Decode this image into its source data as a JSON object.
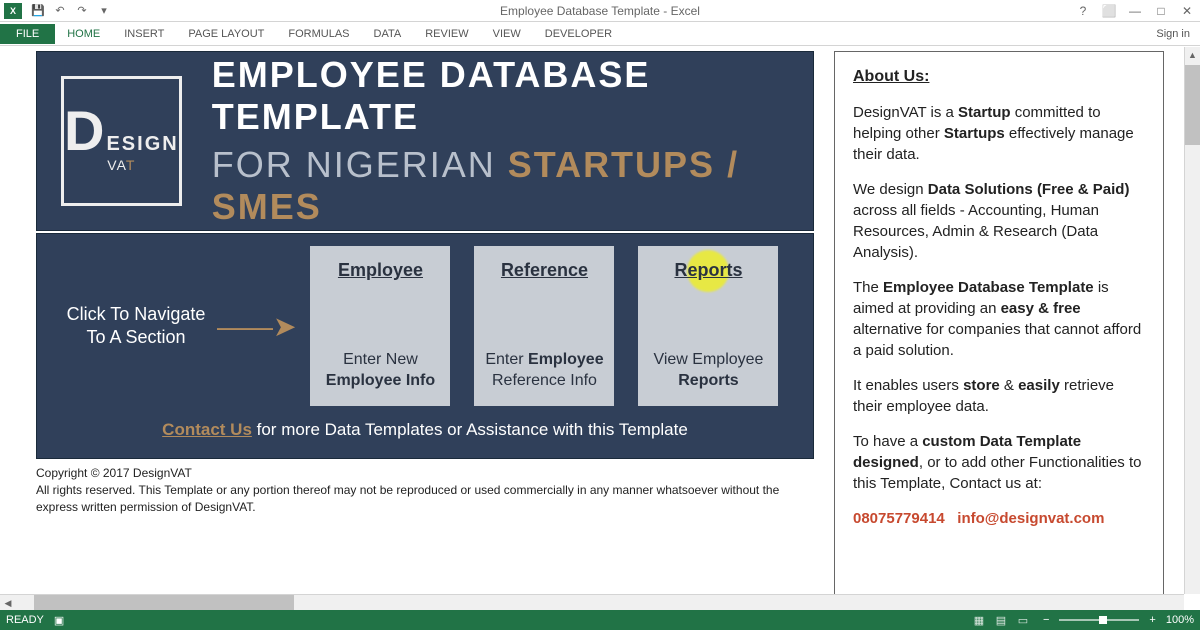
{
  "titlebar": {
    "doc_title": "Employee Database Template - Excel",
    "help_icon": "?",
    "restore_icon": "⬜",
    "min_icon": "—",
    "max_icon": "□",
    "close_icon": "✕"
  },
  "ribbon": {
    "file": "FILE",
    "tabs": [
      "HOME",
      "INSERT",
      "PAGE LAYOUT",
      "FORMULAS",
      "DATA",
      "REVIEW",
      "VIEW",
      "DEVELOPER"
    ],
    "signin": "Sign in"
  },
  "hero": {
    "logo_top": "D",
    "logo_side": "ESIGN",
    "logo_bottom_pre": "VA",
    "logo_bottom_accent": "T",
    "line1": "EMPLOYEE DATABASE TEMPLATE",
    "line2_for": "FOR NIGERIAN ",
    "line2_accent": "STARTUPS / SMES"
  },
  "nav": {
    "hint_l1": "Click To Navigate",
    "hint_l2": "To A Section",
    "arrow": "――➤",
    "cards": [
      {
        "title": "Employee",
        "desc_pre": "Enter New",
        "desc_bold": "Employee Info",
        "highlight": false
      },
      {
        "title": "Reference",
        "desc_pre": "Enter ",
        "desc_bold": "Employee",
        "desc_post": " Reference Info",
        "highlight": false
      },
      {
        "title": "Reports",
        "desc_pre": "View Employee",
        "desc_bold": "Reports",
        "highlight": true
      }
    ],
    "contact_link": "Contact Us",
    "contact_rest": " for more Data Templates or Assistance with this Template"
  },
  "copyright": {
    "line1": "Copyright © 2017 DesignVAT",
    "line2": "All rights reserved. This Template or any portion thereof may not be reproduced or used commercially in any manner whatsoever without the express written permission of DesignVAT."
  },
  "info": {
    "title": "About Us:",
    "p1_pre": "DesignVAT is a ",
    "p1_b1": "Startup",
    "p1_mid": " committed to helping other ",
    "p1_b2": "Startups",
    "p1_post": " effectively manage their data.",
    "p2_pre": "We design ",
    "p2_b": "Data Solutions (Free & Paid)",
    "p2_post": " across all fields - Accounting, Human Resources, Admin & Research (Data Analysis).",
    "p3_pre": "The ",
    "p3_b1": "Employee Database Template",
    "p3_mid": " is aimed at providing an ",
    "p3_b2": "easy & free",
    "p3_post": " alternative for companies that cannot afford a paid solution.",
    "p4_pre": "It enables users ",
    "p4_b1": "store",
    "p4_mid": " & ",
    "p4_b2": "easily",
    "p4_post": " retrieve their employee data.",
    "p5_pre": "To have a ",
    "p5_b": "custom Data Template designed",
    "p5_post": ", or to add other Functionalities to this Template, Contact us at:",
    "phone": "08075779414",
    "email": "info@designvat.com"
  },
  "status": {
    "ready": "READY",
    "zoom": "100%"
  }
}
